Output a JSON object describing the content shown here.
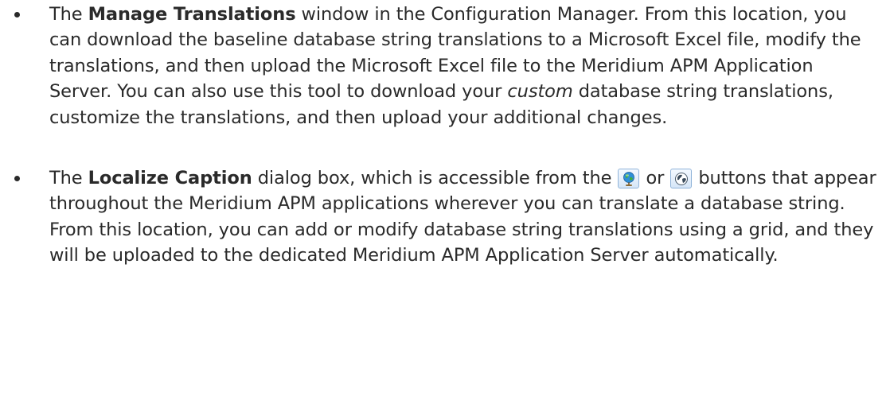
{
  "bullets": [
    {
      "text_1": "The ",
      "bold_1": "Manage Translations",
      "text_2": " window in the Configuration Manager. From this location, you can download the baseline database string translations to a Microsoft Excel file, modify the translations, and then upload the Microsoft Excel file to the Meridium APM Application Server. You can also use this tool to download your ",
      "italic_1": "custom",
      "text_3": " database string translations, customize the translations, and then upload your additional changes."
    },
    {
      "text_1": "The ",
      "bold_1": "Localize Caption",
      "text_2": " dialog box, which is accessible from the ",
      "icon_1": "globe-stand-icon",
      "text_3": " or ",
      "icon_2": "globe-icon",
      "text_4": " buttons that appear throughout the Meridium APM applications wherever you can translate a database string. From this location, you can add or modify database string translations using a grid, and they will be uploaded to the dedicated Meridium APM Application Server automatically."
    }
  ]
}
